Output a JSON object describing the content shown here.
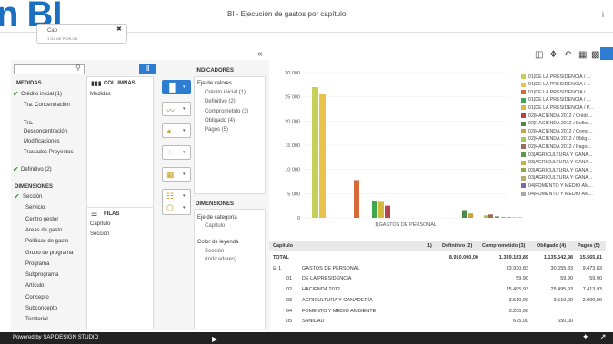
{
  "header": {
    "logo_text": "n BI",
    "app_title": "BI - Ejecución de gastos por capítulo",
    "info_icon": "i",
    "tab_title": "Cap",
    "tab_subtitle": "1 GA    DE P     ON     GA"
  },
  "left": {
    "collapse_icon": "«",
    "measures_title": "MEDIDAS",
    "measures": [
      {
        "label": "Crédito inicial (1)",
        "checked": true
      },
      {
        "label": "Tra. Concentración",
        "checked": false
      },
      {
        "label": "Tra. Desconcentración",
        "checked": false
      },
      {
        "label": "Modificaciones",
        "checked": false
      },
      {
        "label": "Traslados Proyectos",
        "checked": false
      },
      {
        "label": "Definitivo (2)",
        "checked": true
      }
    ],
    "dimensions_title": "DIMENSIONES",
    "dimensions": [
      {
        "label": "Sección",
        "checked": true
      },
      {
        "label": "Servicio"
      },
      {
        "label": "Centro gestor"
      },
      {
        "label": "Areas de gasto"
      },
      {
        "label": "Políticas de gasto"
      },
      {
        "label": "Grupo de programa"
      },
      {
        "label": "Programa"
      },
      {
        "label": "Subprograma"
      },
      {
        "label": "Artículo"
      },
      {
        "label": "Concepto"
      },
      {
        "label": "Subconcepto"
      },
      {
        "label": "Territorial"
      }
    ],
    "columns_title": "COLUMNAS",
    "columns_items": [
      "Medidas"
    ],
    "rows_title": "FILAS",
    "rows_items": [
      "Capítulo",
      "Sección"
    ],
    "indicators_title": "INDICADORES",
    "axis_values_title": "Eje de valores",
    "axis_values": [
      "Crédito inicial (1)",
      "Definitivo (2)",
      "Comprometido (3)",
      "Obligado (4)",
      "Pagos (5)"
    ],
    "dim_title": "DIMENSIONES",
    "cat_axis_title": "Eje de categoría",
    "cat_axis_items": [
      "Capítulo"
    ],
    "legend_color_title": "Color de leyenda",
    "legend_color_items": [
      "Sección",
      "(Indicadores)"
    ]
  },
  "chart_data": {
    "type": "bar",
    "categories": [
      "1|GASTOS DE PERSONAL"
    ],
    "yticks": [
      "30 000",
      "25 000",
      "20 000",
      "15 000",
      "10 000",
      "5 000",
      "0"
    ],
    "ylim": [
      0,
      30000
    ],
    "series": [
      {
        "name": "01|DE LA PRESIDENCIA / ...",
        "color": "#c6cf5a",
        "value": 27000
      },
      {
        "name": "01|DE LA PRESIDENCIA / ...",
        "color": "#e8c24a",
        "value": 25500
      },
      {
        "name": "01|DE LA PRESIDENCIA / ...",
        "color": "#d86a3a",
        "value": 7800
      },
      {
        "name": "01|DE LA PRESIDENCIA / ...",
        "color": "#3fa84a",
        "value": 3500
      },
      {
        "name": "01|DE LA PRESIDENCIA / P...",
        "color": "#d6b83a",
        "value": 3300
      },
      {
        "name": "02|HACIENDA 2012 / Crédit...",
        "color": "#b6454a",
        "value": 2500
      },
      {
        "name": "02|HACIENDA 2012 / Defini...",
        "color": "#4d8a4a",
        "value": 1600
      },
      {
        "name": "02|HACIENDA 2012 / Comp...",
        "color": "#c8a23a",
        "value": 900
      },
      {
        "name": "02|HACIENDA 2012 / Oblig...",
        "color": "#a8c45a",
        "value": 500
      },
      {
        "name": "02|HACIENDA 2012 / Pago...",
        "color": "#9c6a5a",
        "value": 700
      },
      {
        "name": "03|AGRICULTURA Y GANA...",
        "color": "#5a9a4a",
        "value": 300
      },
      {
        "name": "03|AGRICULTURA Y GANA...",
        "color": "#c9b04a",
        "value": 200
      },
      {
        "name": "03|AGRICULTURA Y GANA...",
        "color": "#8fa84a",
        "value": 150
      },
      {
        "name": "03|AGRICULTURA Y GANA...",
        "color": "#b8a86a",
        "value": 100
      },
      {
        "name": "04|FOMENTO Y MEDIO AM...",
        "color": "#7a6aa8",
        "value": 80
      },
      {
        "name": "04|FOMENTO Y MEDIO AM...",
        "color": "#a8a8a8",
        "value": 50
      }
    ]
  },
  "table": {
    "headers": [
      "Capítulo",
      "1)",
      "Definitivo (2)",
      "Comprometido (3)",
      "Obligado (4)",
      "Pagos (5)"
    ],
    "rows": [
      {
        "code": "TOTAL",
        "name": "",
        "def": "8.910.000,00",
        "comp": "1.339.183,89",
        "obl": "1.135.542,98",
        "pag": "15.565,81",
        "bold": true
      },
      {
        "code": "⊟ 1",
        "name": "GASTOS DE PERSONAL",
        "def": "",
        "comp": "33.930,83",
        "obl": "30.655,83",
        "pag": "9.473,83"
      },
      {
        "code": "01",
        "name": "DE LA PRESIDENCIA",
        "def": "",
        "comp": "59,90",
        "obl": "59,90",
        "pag": "59,90"
      },
      {
        "code": "02",
        "name": "HACIENDA 2012",
        "def": "",
        "comp": "25.495,93",
        "obl": "25.495,93",
        "pag": "7.413,93"
      },
      {
        "code": "03",
        "name": "AGRICULTURA Y GANADERÍA",
        "def": "",
        "comp": "3.510,00",
        "obl": "3.510,00",
        "pag": "2.000,00"
      },
      {
        "code": "04",
        "name": "FOMENTO Y MEDIO AMBIENTE",
        "def": "",
        "comp": "3.250,00",
        "obl": "",
        "pag": ""
      },
      {
        "code": "05",
        "name": "SANIDAD",
        "def": "",
        "comp": "675,00",
        "obl": "650,00",
        "pag": ""
      }
    ]
  },
  "footer": {
    "powered": "Powered by SAP DESIGN STUDIO"
  }
}
